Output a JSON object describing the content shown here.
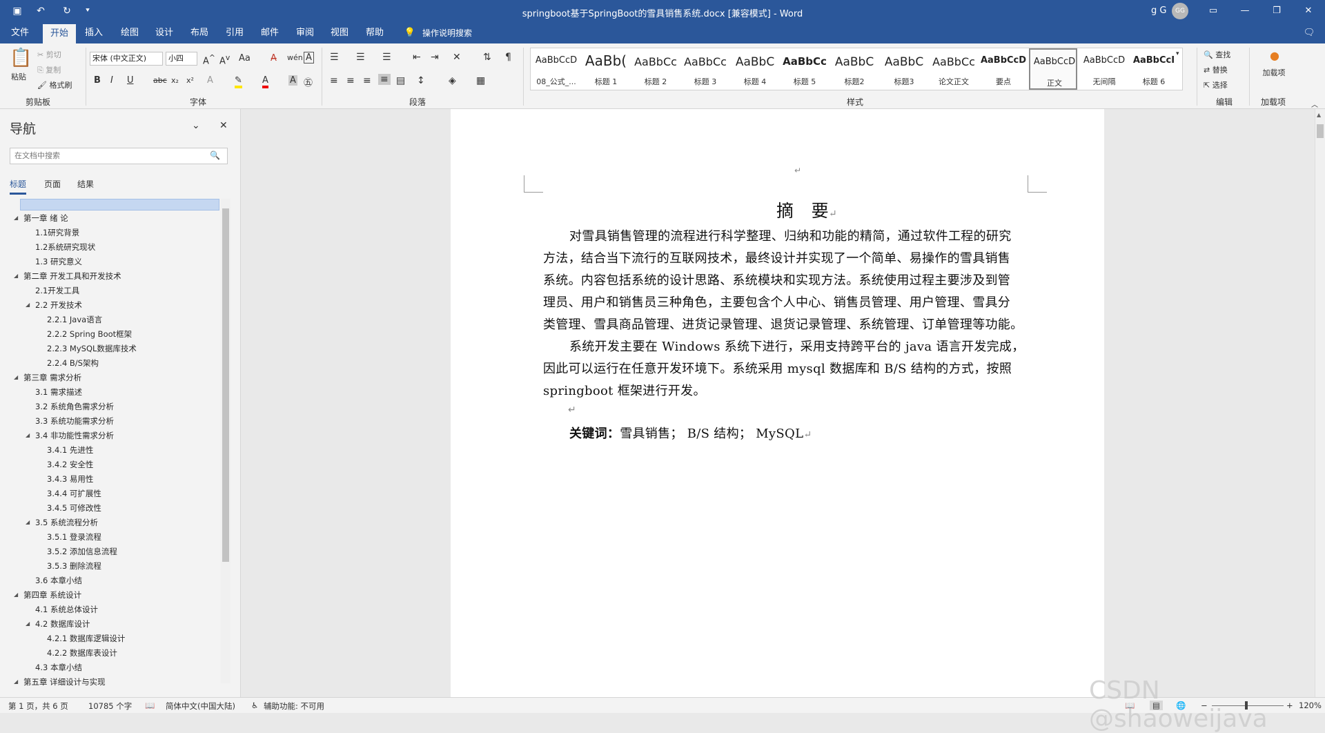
{
  "window": {
    "title": "springboot基于SpringBoot的雪具销售系统.docx [兼容模式] - Word",
    "user": "g G",
    "avatar": "GG"
  },
  "tabs": [
    "文件",
    "开始",
    "插入",
    "绘图",
    "设计",
    "布局",
    "引用",
    "邮件",
    "审阅",
    "视图",
    "帮助"
  ],
  "tell_me": "操作说明搜索",
  "ribbon": {
    "clipboard": {
      "paste": "粘贴",
      "cut": "剪切",
      "copy": "复制",
      "format_painter": "格式刷",
      "label": "剪贴板"
    },
    "font": {
      "family": "宋体 (中文正文)",
      "size": "小四",
      "label": "字体"
    },
    "paragraph": {
      "label": "段落"
    },
    "styles": {
      "label": "样式",
      "items": [
        {
          "preview": "AaBbCcD",
          "name": "08_公式_..."
        },
        {
          "preview": "AaBb(",
          "name": "标题 1"
        },
        {
          "preview": "AaBbCc",
          "name": "标题 2"
        },
        {
          "preview": "AaBbCc",
          "name": "标题 3"
        },
        {
          "preview": "AaBbC",
          "name": "标题 4"
        },
        {
          "preview": "AaBbCc",
          "name": "标题 5"
        },
        {
          "preview": "AaBbC",
          "name": "标题2"
        },
        {
          "preview": "AaBbC",
          "name": "标题3"
        },
        {
          "preview": "AaBbCc",
          "name": "论文正文"
        },
        {
          "preview": "AaBbCcD",
          "name": "要点"
        },
        {
          "preview": "AaBbCcD",
          "name": "正文"
        },
        {
          "preview": "AaBbCcD",
          "name": "无间隔"
        },
        {
          "preview": "AaBbCcI",
          "name": "标题 6"
        }
      ]
    },
    "editing": {
      "find": "查找",
      "replace": "替换",
      "select": "选择",
      "label": "编辑"
    },
    "addins": {
      "button": "加载项",
      "label": "加载项"
    }
  },
  "nav": {
    "title": "导航",
    "search_placeholder": "在文档中搜索",
    "tabs": [
      "标题",
      "页面",
      "结果"
    ],
    "headings": [
      "第一章 绪 论",
      "1.1研究背景",
      "1.2系统研究现状",
      "1.3 研究意义",
      "第二章 开发工具和开发技术",
      "2.1开发工具",
      "2.2 开发技术",
      "2.2.1 Java语言",
      "2.2.2 Spring Boot框架",
      "2.2.3 MySQL数据库技术",
      "2.2.4 B/S架构",
      "第三章 需求分析",
      "3.1 需求描述",
      "3.2 系统角色需求分析",
      "3.3 系统功能需求分析",
      "3.4 非功能性需求分析",
      "3.4.1 先进性",
      "3.4.2 安全性",
      "3.4.3 易用性",
      "3.4.4 可扩展性",
      "3.4.5 可修改性",
      "3.5 系统流程分析",
      "3.5.1 登录流程",
      "3.5.2 添加信息流程",
      "3.5.3 删除流程",
      "3.6 本章小结",
      "第四章 系统设计",
      "4.1 系统总体设计",
      "4.2 数据库设计",
      "4.2.1 数据库逻辑设计",
      "4.2.2 数据库表设计",
      "4.3 本章小结",
      "第五章 详细设计与实现"
    ]
  },
  "document": {
    "title": "摘　要",
    "lines": [
      "对雪具销售管理的流程进行科学整理、归纳和功能的精简，通过软件工程的研究",
      "方法，结合当下流行的互联网技术，最终设计并实现了一个简单、易操作的雪具销售",
      "系统。内容包括系统的设计思路、系统模块和实现方法。系统使用过程主要涉及到管",
      "理员、用户和销售员三种角色，主要包含个人中心、销售员管理、用户管理、雪具分",
      "类管理、雪具商品管理、进货记录管理、退货记录管理、系统管理、订单管理等功能。",
      "系统开发主要在 Windows 系统下进行，采用支持跨平台的 java 语言开发完成，",
      "因此可以运行在任意开发环境下。系统采用 mysql 数据库和 B/S 结构的方式，按照",
      "springboot 框架进行开发。"
    ],
    "keywords_label": "关键词：",
    "keywords": "雪具销售； B/S 结构； MySQL"
  },
  "status": {
    "page": "第 1 页，共 6 页",
    "words": "10785 个字",
    "language": "简体中文(中国大陆)",
    "accessibility": "辅助功能: 不可用",
    "zoom": "120%"
  },
  "watermark": "CSDN @shaoweijava"
}
